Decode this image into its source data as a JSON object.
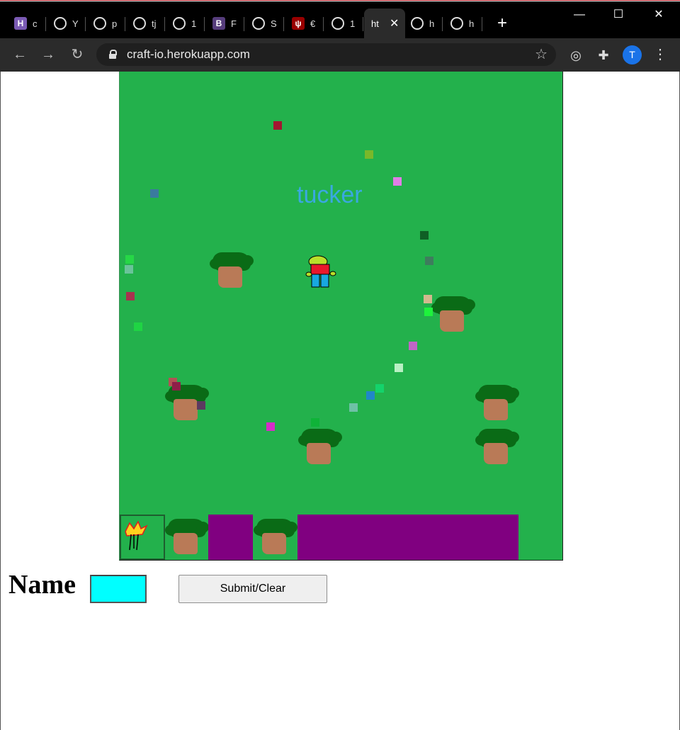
{
  "browser": {
    "tabs": [
      {
        "icon": "heroku-icon",
        "glyph": "H",
        "color": "#7a5ab3",
        "label": "c"
      },
      {
        "icon": "github-icon",
        "glyph": "",
        "color": "#000000",
        "label": "Y"
      },
      {
        "icon": "github-icon",
        "glyph": "",
        "color": "#000000",
        "label": "p"
      },
      {
        "icon": "github-icon",
        "glyph": "",
        "color": "#000000",
        "label": "tj"
      },
      {
        "icon": "globe-icon",
        "glyph": "",
        "color": "#000000",
        "label": "1"
      },
      {
        "icon": "bootstrap-icon",
        "glyph": "B",
        "color": "#563d7c",
        "label": "F"
      },
      {
        "icon": "speedometer-icon",
        "glyph": "",
        "color": "#000000",
        "label": "S"
      },
      {
        "icon": "iu-trident-icon",
        "glyph": "ψ",
        "color": "#990000",
        "label": "€"
      },
      {
        "icon": "globe-icon",
        "glyph": "",
        "color": "#000000",
        "label": "1"
      },
      {
        "icon": "",
        "glyph": "",
        "color": "#000000",
        "label": "ht"
      },
      {
        "icon": "globe-icon",
        "glyph": "",
        "color": "#000000",
        "label": "h"
      },
      {
        "icon": "globe-icon",
        "glyph": "",
        "color": "#000000",
        "label": "h"
      }
    ],
    "active_tab_index": 9,
    "new_tab_glyph": "+",
    "window_controls": {
      "minimize": "—",
      "maximize": "☐",
      "close": "✕"
    },
    "url": "craft-io.herokuapp.com",
    "profile_initial": "T"
  },
  "game": {
    "background": "#23b14c",
    "player_name": "tucker",
    "player_name_color": "#3aa8e0",
    "pellet_colors": [
      "#a31530",
      "#7ab82a",
      "#e07ee6",
      "#3a7a9e",
      "#0f5f25",
      "#3e7d5d",
      "#26d746",
      "#6ac39a",
      "#a8334f",
      "#1fd444",
      "#d2b98e",
      "#1ef23c",
      "#c066c6",
      "#b9f0c4",
      "#14d36b",
      "#2087c8",
      "#6ec1a6",
      "#b05454",
      "#8e1f48",
      "#5c3a60",
      "#d62cc8",
      "#0fb338"
    ],
    "hotbar": {
      "slots": [
        {
          "kind": "torch",
          "selected": true
        },
        {
          "kind": "tree",
          "selected": false
        },
        {
          "kind": "empty",
          "color": "#800080",
          "selected": false
        },
        {
          "kind": "tree",
          "selected": false
        },
        {
          "kind": "empty",
          "color": "#800080",
          "selected": false
        }
      ]
    }
  },
  "form": {
    "name_label": "Name",
    "name_value": "",
    "input_color": "#00ffff",
    "submit_label": "Submit/Clear"
  }
}
